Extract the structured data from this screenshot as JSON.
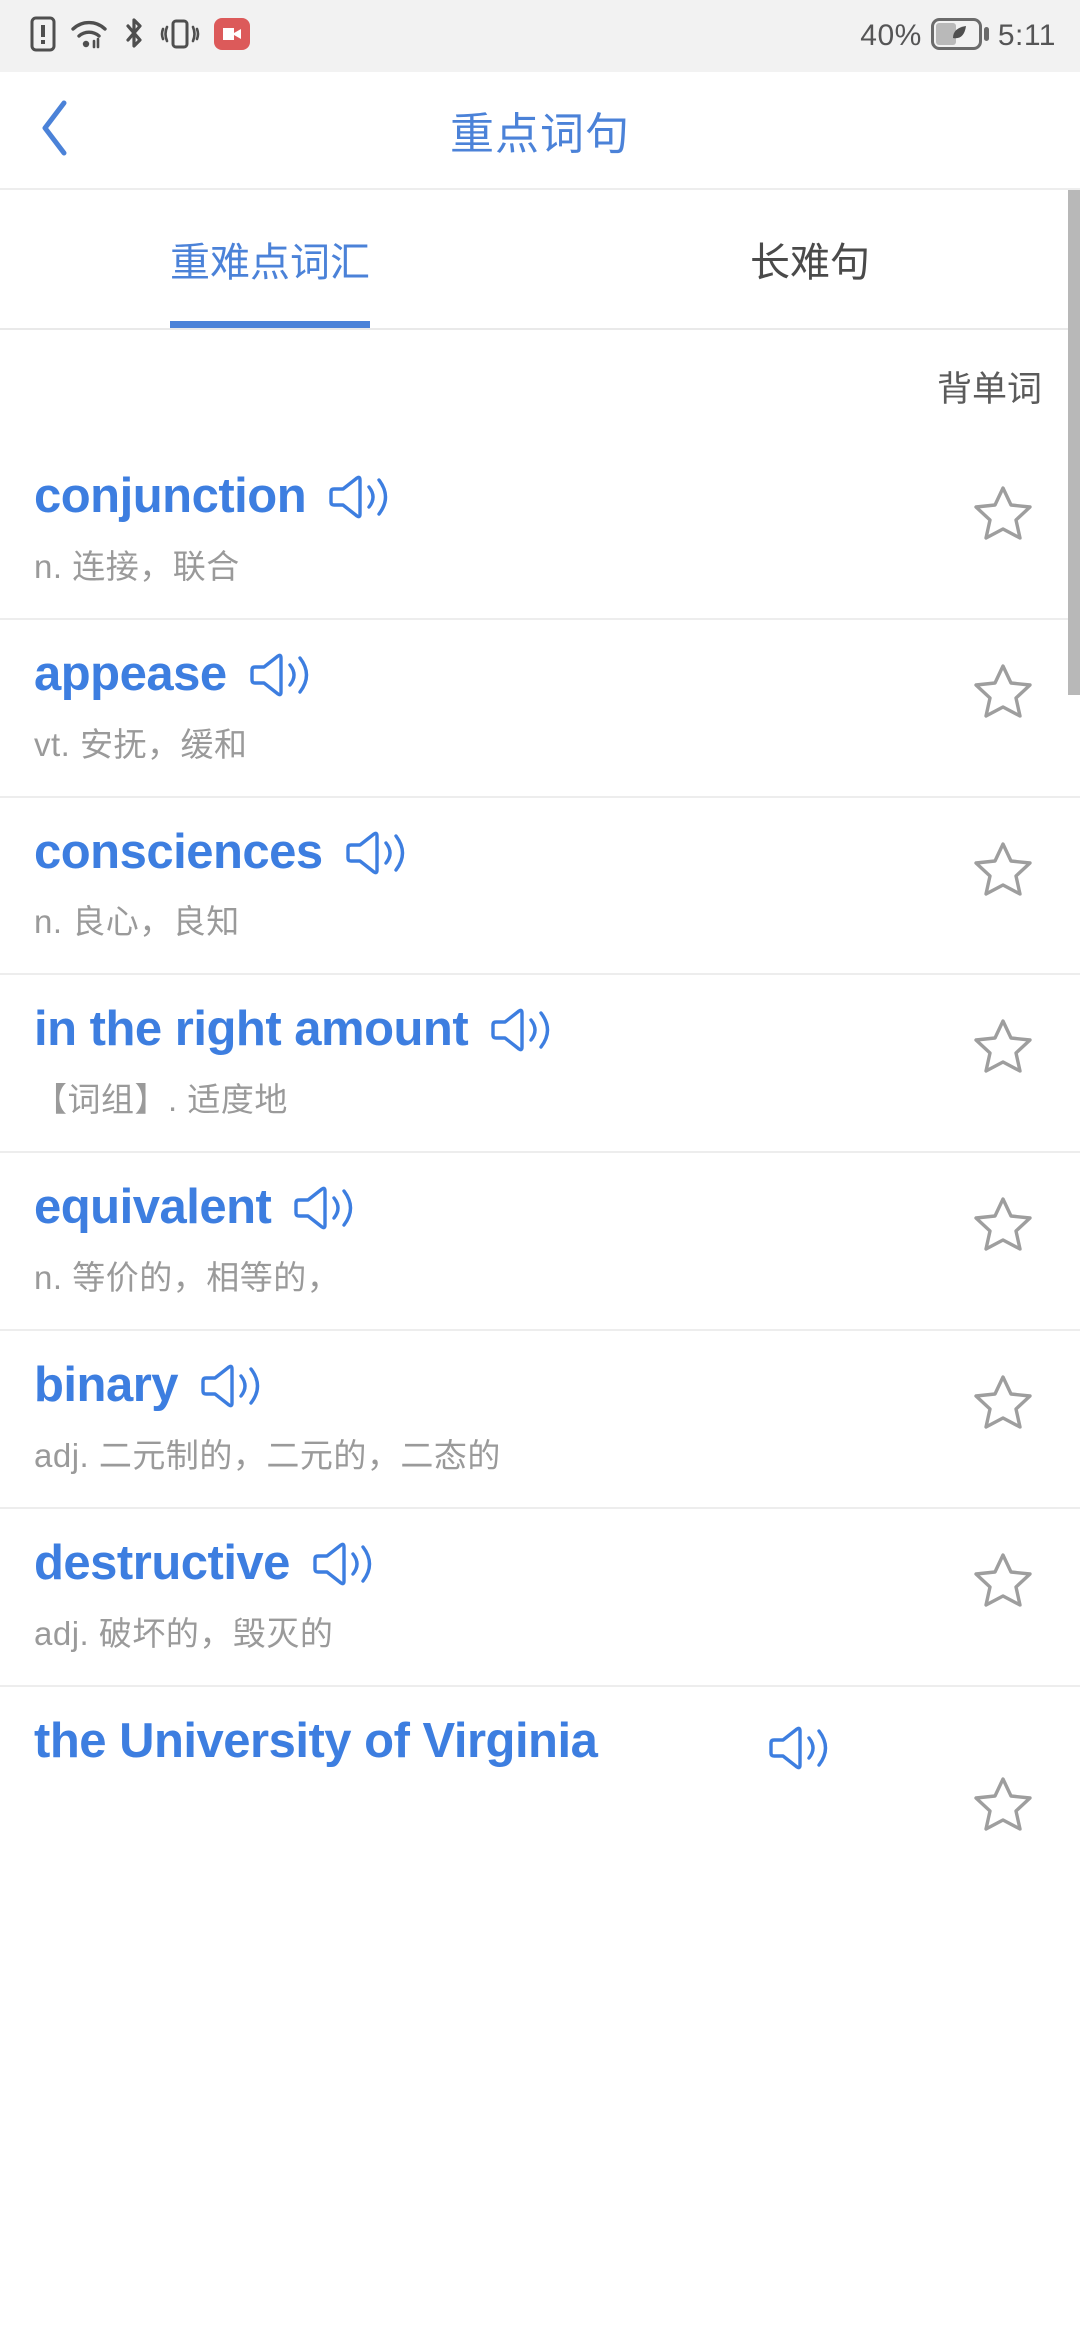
{
  "status_bar": {
    "icons": [
      "sim-alert-icon",
      "wifi-icon",
      "bluetooth-icon",
      "vibrate-icon",
      "screen-record-icon"
    ],
    "battery_percent": "40%",
    "battery_mode_icon": "battery-saver-leaf-icon",
    "time": "5:11"
  },
  "header": {
    "back_icon": "back-chevron-icon",
    "title": "重点词句"
  },
  "tabs": [
    {
      "label": "重难点词汇",
      "active": true
    },
    {
      "label": "长难句",
      "active": false
    }
  ],
  "toolbar": {
    "memorize_label": "背单词"
  },
  "colors": {
    "accent_blue": "#4b82d8",
    "word_blue": "#3d7ee0",
    "definition_gray": "#9a9a9a",
    "status_bg": "#f2f2f2",
    "divider": "#ededed",
    "star_outline": "#9e9e9e",
    "scrollbar": "#b8b8b8"
  },
  "words": [
    {
      "term": "conjunction",
      "definition": "n. 连接，联合",
      "speaker_icon": "speaker-icon",
      "star_icon": "star-outline-icon",
      "starred": false
    },
    {
      "term": "appease",
      "definition": "vt. 安抚，缓和",
      "speaker_icon": "speaker-icon",
      "star_icon": "star-outline-icon",
      "starred": false
    },
    {
      "term": "consciences",
      "definition": "n. 良心，良知",
      "speaker_icon": "speaker-icon",
      "star_icon": "star-outline-icon",
      "starred": false
    },
    {
      "term": "in the right amount",
      "definition": "【词组】. 适度地",
      "speaker_icon": "speaker-icon",
      "star_icon": "star-outline-icon",
      "starred": false
    },
    {
      "term": "equivalent",
      "definition": "n. 等价的，相等的，",
      "speaker_icon": "speaker-icon",
      "star_icon": "star-outline-icon",
      "starred": false
    },
    {
      "term": "binary",
      "definition": "adj. 二元制的，二元的，二态的",
      "speaker_icon": "speaker-icon",
      "star_icon": "star-outline-icon",
      "starred": false
    },
    {
      "term": "destructive",
      "definition": "adj. 破坏的，毁灭的",
      "speaker_icon": "speaker-icon",
      "star_icon": "star-outline-icon",
      "starred": false
    },
    {
      "term": "the University of Virginia",
      "definition": "",
      "speaker_icon": "speaker-icon",
      "star_icon": "star-outline-icon",
      "starred": false
    }
  ],
  "scrollbar": {
    "visible": true
  }
}
